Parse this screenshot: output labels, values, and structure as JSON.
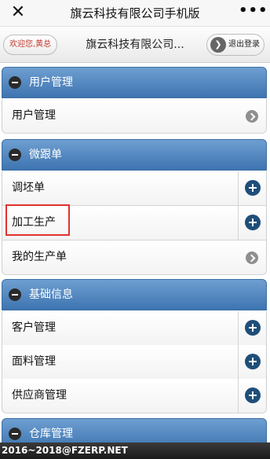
{
  "titlebar": {
    "close_icon": "close-icon",
    "title": "旗云科技有限公司手机版",
    "more_label": "•••"
  },
  "header": {
    "welcome": "欢迎您,黄总",
    "app_title": "旗云科技有限公司...",
    "logout_label": "退出登录",
    "logout_icon_glyph": "❯"
  },
  "sections": [
    {
      "title": "用户管理",
      "items": [
        {
          "label": "用户管理",
          "action": "arrow"
        }
      ]
    },
    {
      "title": "微跟单",
      "items": [
        {
          "label": "调坯单",
          "action": "plus"
        },
        {
          "label": "加工生产",
          "action": "plus",
          "highlighted": true
        },
        {
          "label": "我的生产单",
          "action": "arrow"
        }
      ]
    },
    {
      "title": "基础信息",
      "items": [
        {
          "label": "客户管理",
          "action": "plus"
        },
        {
          "label": "面料管理",
          "action": "plus"
        },
        {
          "label": "供应商管理",
          "action": "plus"
        }
      ]
    },
    {
      "title": "仓库管理",
      "items": []
    }
  ],
  "colors": {
    "section_header": "#4d82bf",
    "add_button": "#1f4e79",
    "highlight_border": "#e0332f",
    "welcome_text": "#c0392b"
  },
  "footer": {
    "text": "2016~2018@FZERP.NET"
  }
}
